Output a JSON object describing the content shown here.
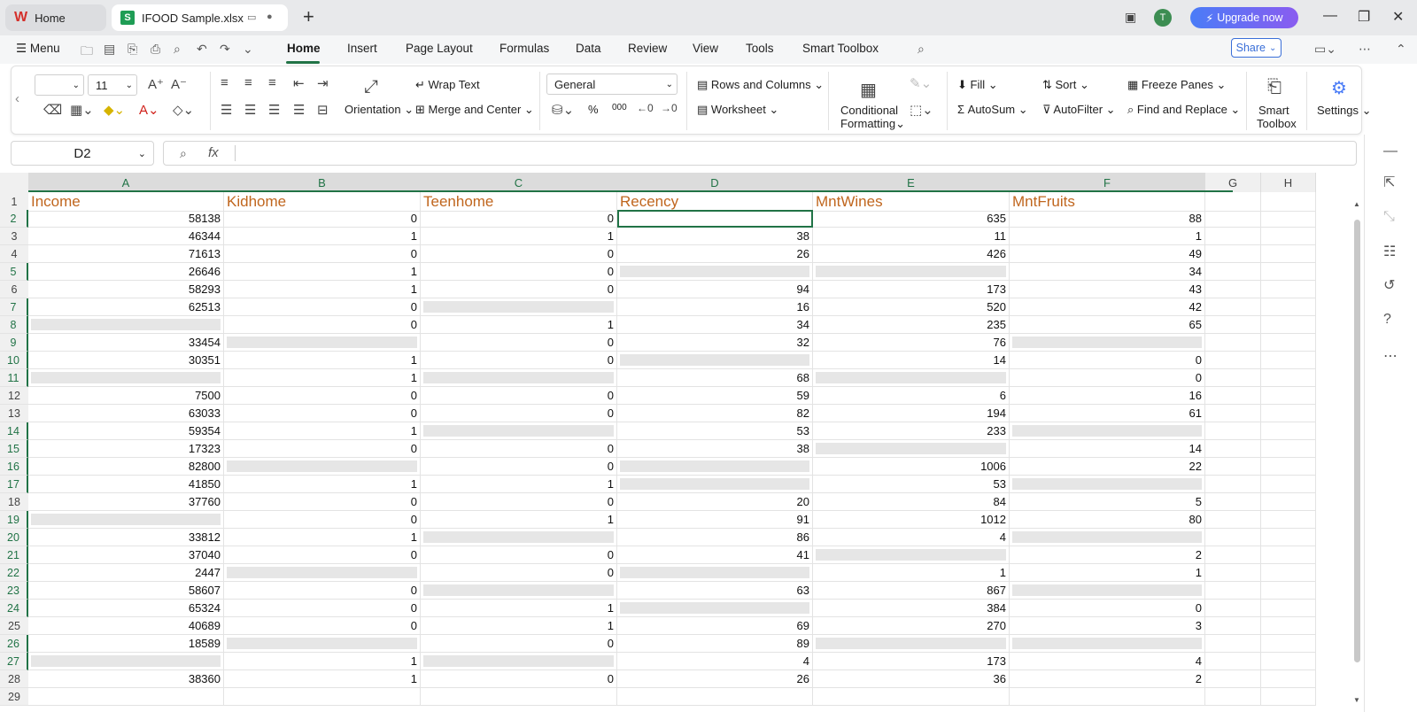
{
  "tabs": {
    "home_label": "Home",
    "file_label": "IFOOD Sample.xlsx"
  },
  "titlebar": {
    "avatar_letter": "T",
    "upgrade_label": "Upgrade now"
  },
  "menu": {
    "menu_label": "Menu",
    "items": [
      "Home",
      "Insert",
      "Page Layout",
      "Formulas",
      "Data",
      "Review",
      "View",
      "Tools",
      "Smart Toolbox"
    ],
    "share_label": "Share"
  },
  "ribbon": {
    "font_size": "11",
    "wrap_text": "Wrap Text",
    "merge_center": "Merge and Center",
    "orientation": "Orientation",
    "number_format": "General",
    "rows_columns": "Rows and Columns",
    "worksheet": "Worksheet",
    "conditional": "Conditional",
    "formatting": "Formatting",
    "fill": "Fill",
    "sort": "Sort",
    "freeze": "Freeze Panes",
    "autosum": "AutoSum",
    "autofilter": "AutoFilter",
    "find_replace": "Find and Replace",
    "smart": "Smart",
    "toolbox": "Toolbox",
    "settings": "Settings",
    "percent": "%",
    "thousands": "000"
  },
  "formula": {
    "cell_ref": "D2",
    "fx": "fx",
    "content": ""
  },
  "sheet": {
    "columns": [
      "A",
      "B",
      "C",
      "D",
      "E",
      "F",
      "G",
      "H"
    ],
    "header_row": [
      "Income",
      "Kidhome",
      "Teenhome",
      "Recency",
      "MntWines",
      "MntFruits"
    ],
    "rows": [
      {
        "n": "2",
        "v": [
          "58138",
          "0",
          "0",
          "",
          "635",
          "88"
        ],
        "g": []
      },
      {
        "n": "3",
        "v": [
          "46344",
          "1",
          "1",
          "38",
          "11",
          "1"
        ],
        "g": []
      },
      {
        "n": "4",
        "v": [
          "71613",
          "0",
          "0",
          "26",
          "426",
          "49"
        ],
        "g": []
      },
      {
        "n": "5",
        "v": [
          "26646",
          "1",
          "0",
          "",
          "",
          "34"
        ],
        "g": [
          3,
          4
        ]
      },
      {
        "n": "6",
        "v": [
          "58293",
          "1",
          "0",
          "94",
          "173",
          "43"
        ],
        "g": []
      },
      {
        "n": "7",
        "v": [
          "62513",
          "0",
          "",
          "16",
          "520",
          "42"
        ],
        "g": [
          2
        ]
      },
      {
        "n": "8",
        "v": [
          "",
          "0",
          "1",
          "34",
          "235",
          "65"
        ],
        "g": [
          0
        ]
      },
      {
        "n": "9",
        "v": [
          "33454",
          "",
          "0",
          "32",
          "76",
          ""
        ],
        "g": [
          1,
          5
        ]
      },
      {
        "n": "10",
        "v": [
          "30351",
          "1",
          "0",
          "",
          "14",
          "0"
        ],
        "g": [
          3
        ]
      },
      {
        "n": "11",
        "v": [
          "",
          "1",
          "",
          "68",
          "",
          "0"
        ],
        "g": [
          0,
          2,
          4
        ]
      },
      {
        "n": "12",
        "v": [
          "7500",
          "0",
          "0",
          "59",
          "6",
          "16"
        ],
        "g": []
      },
      {
        "n": "13",
        "v": [
          "63033",
          "0",
          "0",
          "82",
          "194",
          "61"
        ],
        "g": []
      },
      {
        "n": "14",
        "v": [
          "59354",
          "1",
          "",
          "53",
          "233",
          ""
        ],
        "g": [
          2,
          5
        ]
      },
      {
        "n": "15",
        "v": [
          "17323",
          "0",
          "0",
          "38",
          "",
          "14"
        ],
        "g": [
          4
        ]
      },
      {
        "n": "16",
        "v": [
          "82800",
          "",
          "0",
          "",
          "1006",
          "22"
        ],
        "g": [
          1,
          3
        ]
      },
      {
        "n": "17",
        "v": [
          "41850",
          "1",
          "1",
          "",
          "53",
          ""
        ],
        "g": [
          3,
          5
        ]
      },
      {
        "n": "18",
        "v": [
          "37760",
          "0",
          "0",
          "20",
          "84",
          "5"
        ],
        "g": []
      },
      {
        "n": "19",
        "v": [
          "",
          "0",
          "1",
          "91",
          "1012",
          "80"
        ],
        "g": [
          0
        ]
      },
      {
        "n": "20",
        "v": [
          "33812",
          "1",
          "",
          "86",
          "4",
          ""
        ],
        "g": [
          2,
          5
        ]
      },
      {
        "n": "21",
        "v": [
          "37040",
          "0",
          "0",
          "41",
          "",
          "2"
        ],
        "g": [
          4
        ]
      },
      {
        "n": "22",
        "v": [
          "2447",
          "",
          "0",
          "",
          "1",
          "1"
        ],
        "g": [
          1,
          3
        ]
      },
      {
        "n": "23",
        "v": [
          "58607",
          "0",
          "",
          "63",
          "867",
          ""
        ],
        "g": [
          2,
          5
        ]
      },
      {
        "n": "24",
        "v": [
          "65324",
          "0",
          "1",
          "",
          "384",
          "0"
        ],
        "g": [
          3
        ]
      },
      {
        "n": "25",
        "v": [
          "40689",
          "0",
          "1",
          "69",
          "270",
          "3"
        ],
        "g": []
      },
      {
        "n": "26",
        "v": [
          "18589",
          "",
          "0",
          "89",
          "",
          ""
        ],
        "g": [
          1,
          4,
          5
        ]
      },
      {
        "n": "27",
        "v": [
          "",
          "1",
          "",
          "4",
          "173",
          "4"
        ],
        "g": [
          0,
          2
        ]
      },
      {
        "n": "28",
        "v": [
          "38360",
          "1",
          "0",
          "26",
          "36",
          "2"
        ],
        "g": []
      },
      {
        "n": "29",
        "v": [
          "",
          "",
          "",
          "",
          "",
          ""
        ],
        "g": []
      }
    ],
    "selected_rows": [
      "2",
      "5",
      "7",
      "8",
      "9",
      "10",
      "11",
      "14",
      "15",
      "16",
      "17",
      "19",
      "20",
      "21",
      "22",
      "23",
      "24",
      "26",
      "27"
    ]
  },
  "colors": {
    "accent": "#217346",
    "header_text": "#c0661e",
    "missing_cell": "#e6e6e6"
  }
}
